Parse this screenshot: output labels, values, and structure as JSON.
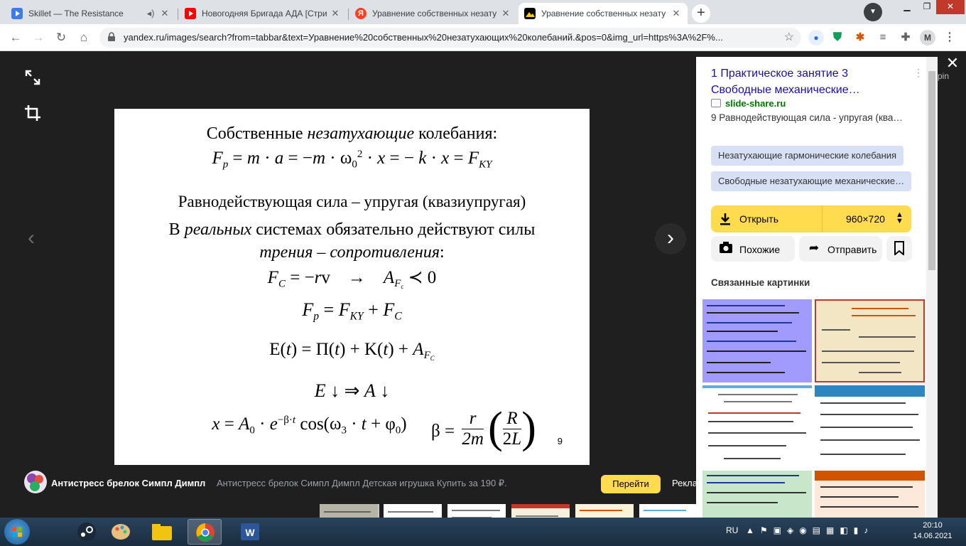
{
  "tabs": [
    {
      "title": "Skillet — The Resistance",
      "has_audio": true
    },
    {
      "title": "Новогодняя Бригада АДА [Стри"
    },
    {
      "title": "Уравнение собственных незату"
    },
    {
      "title": "Уравнение собственных незату",
      "active": true
    }
  ],
  "toolbar": {
    "url": "yandex.ru/images/search?from=tabbar&text=Уравнение%20собственных%20незатухающих%20колебаний.&pos=0&img_url=https%3A%2F%...",
    "profile_initial": "M"
  },
  "slide": {
    "line1_plain": "Собственные ",
    "line1_italic": "незатухающие",
    "line1_end": " колебания:",
    "line2": "Равнодействующая сила – упругая (квазиупругая)",
    "line3_start": "В ",
    "line3_italic": "реальных",
    "line3_end": " системах обязательно действуют силы",
    "line4_italic": "трения – сопротивления",
    "line4_end": ":",
    "page_number": "9"
  },
  "caption": {
    "source": "Антистресс брелок Симпл Димпл",
    "description": "Антистресс брелок Симпл Димпл Детская игрушка Купить за 190 ₽.",
    "go_button": "Перейти",
    "ad_label": "Рекла"
  },
  "panel": {
    "title": "1 Практическое занятие 3 Свободные механические…",
    "site": "slide-share.ru",
    "snippet": "9 Равнодействующая сила - упругая (ква…",
    "chips": [
      "Незатухающие гармонические колебания",
      "Свободные незатухающие механические…"
    ],
    "open_label": "Открыть",
    "size": "960×720",
    "similar_label": "Похожие",
    "share_label": "Отправить",
    "related_heading": "Связанные картинки",
    "side_text": "pin"
  },
  "taskbar": {
    "lang": "RU",
    "time": "20:10",
    "date": "14.06.2021"
  },
  "colors": {
    "accent_yellow": "#ffdb4d",
    "link_blue": "#1a0dab",
    "site_green": "#007700",
    "chip_blue": "#d7e0f5"
  }
}
